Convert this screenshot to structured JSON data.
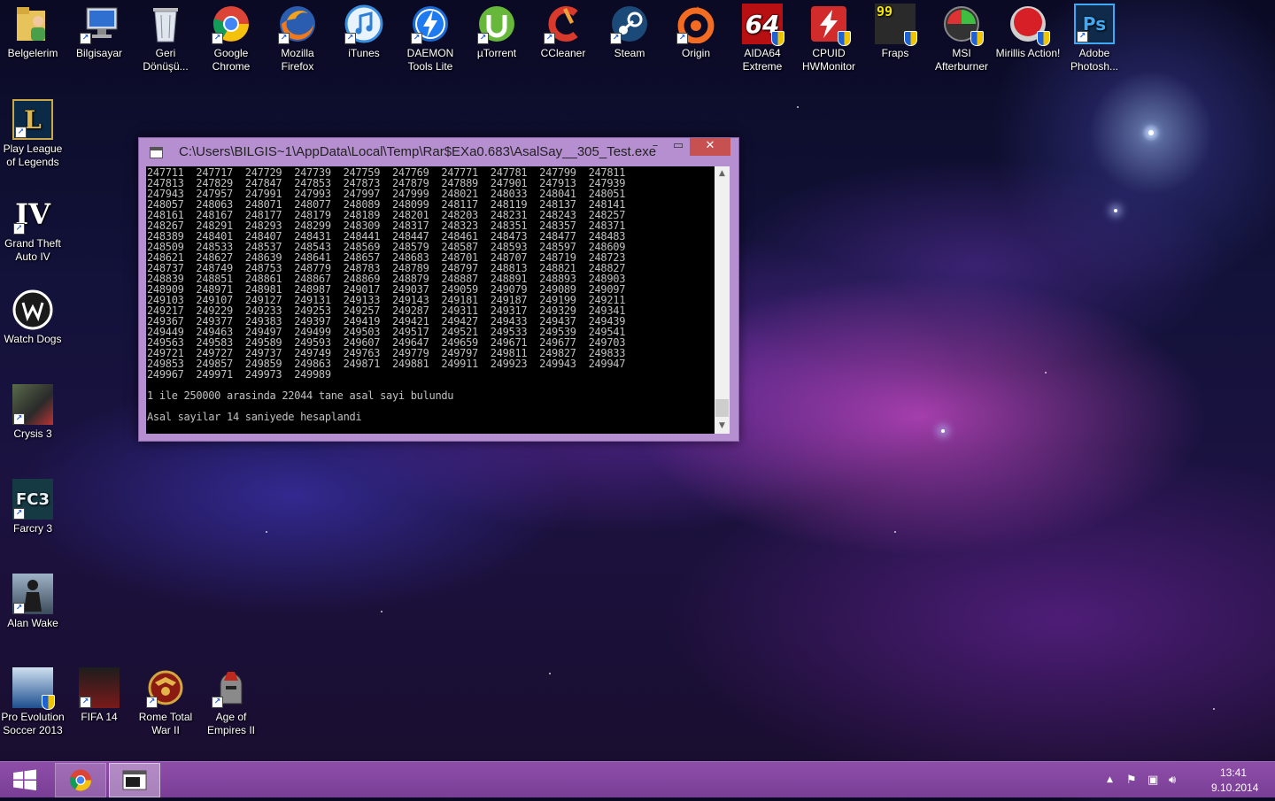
{
  "desktop": {
    "top_row": [
      {
        "label": "Belgelerim",
        "icon": "user-folder-icon"
      },
      {
        "label": "Bilgisayar",
        "icon": "computer-icon"
      },
      {
        "label": "Geri Dönüşü...",
        "icon": "recycle-bin-icon"
      },
      {
        "label": "Google Chrome",
        "icon": "chrome-icon"
      },
      {
        "label": "Mozilla Firefox",
        "icon": "firefox-icon"
      },
      {
        "label": "iTunes",
        "icon": "itunes-icon"
      },
      {
        "label": "DAEMON Tools Lite",
        "icon": "daemon-tools-icon"
      },
      {
        "label": "µTorrent",
        "icon": "utorrent-icon"
      },
      {
        "label": "CCleaner",
        "icon": "ccleaner-icon"
      },
      {
        "label": "Steam",
        "icon": "steam-icon"
      },
      {
        "label": "Origin",
        "icon": "origin-icon"
      },
      {
        "label": "AIDA64 Extreme",
        "icon": "aida64-icon",
        "glyph": "64"
      },
      {
        "label": "CPUID HWMonitor",
        "icon": "hwmonitor-icon"
      },
      {
        "label": "Fraps",
        "icon": "fraps-icon",
        "glyph": "99"
      },
      {
        "label": "MSI Afterburner",
        "icon": "afterburner-icon"
      },
      {
        "label": "Mirillis Action!",
        "icon": "mirillis-action-icon"
      },
      {
        "label": "Adobe Photosh...",
        "icon": "photoshop-icon",
        "glyph": "Ps"
      }
    ],
    "left_column": [
      {
        "label": "Play League of Legends",
        "icon": "league-of-legends-icon",
        "glyph": "L"
      },
      {
        "label": "Grand Theft Auto IV",
        "icon": "gta-iv-icon",
        "glyph": "IV"
      },
      {
        "label": "Watch Dogs",
        "icon": "watch-dogs-icon"
      },
      {
        "label": "Crysis 3",
        "icon": "crysis-3-icon"
      },
      {
        "label": "Farcry 3",
        "icon": "farcry-3-icon",
        "glyph": "FC3"
      },
      {
        "label": "Alan Wake",
        "icon": "alan-wake-icon"
      }
    ],
    "bottom_row": [
      {
        "label": "Pro Evolution Soccer 2013",
        "icon": "pes-2013-icon"
      },
      {
        "label": "FIFA 14",
        "icon": "fifa-14-icon"
      },
      {
        "label": "Rome Total War II",
        "icon": "rome-total-war-icon"
      },
      {
        "label": "Age of Empires II",
        "icon": "age-of-empires-icon"
      }
    ]
  },
  "console": {
    "title": "C:\\Users\\BILGIS~1\\AppData\\Local\\Temp\\Rar$EXa0.683\\AsalSay__305_Test.exe",
    "buttons": {
      "minimize": "–",
      "maximize": "▭",
      "close": "✕"
    },
    "primes": [
      [
        247711,
        247717,
        247729,
        247739,
        247759,
        247769,
        247771,
        247781,
        247799,
        247811
      ],
      [
        247813,
        247829,
        247847,
        247853,
        247873,
        247879,
        247889,
        247901,
        247913,
        247939
      ],
      [
        247943,
        247957,
        247991,
        247993,
        247997,
        247999,
        248021,
        248033,
        248041,
        248051
      ],
      [
        248057,
        248063,
        248071,
        248077,
        248089,
        248099,
        248117,
        248119,
        248137,
        248141
      ],
      [
        248161,
        248167,
        248177,
        248179,
        248189,
        248201,
        248203,
        248231,
        248243,
        248257
      ],
      [
        248267,
        248291,
        248293,
        248299,
        248309,
        248317,
        248323,
        248351,
        248357,
        248371
      ],
      [
        248389,
        248401,
        248407,
        248431,
        248441,
        248447,
        248461,
        248473,
        248477,
        248483
      ],
      [
        248509,
        248533,
        248537,
        248543,
        248569,
        248579,
        248587,
        248593,
        248597,
        248609
      ],
      [
        248621,
        248627,
        248639,
        248641,
        248657,
        248683,
        248701,
        248707,
        248719,
        248723
      ],
      [
        248737,
        248749,
        248753,
        248779,
        248783,
        248789,
        248797,
        248813,
        248821,
        248827
      ],
      [
        248839,
        248851,
        248861,
        248867,
        248869,
        248879,
        248887,
        248891,
        248893,
        248903
      ],
      [
        248909,
        248971,
        248981,
        248987,
        249017,
        249037,
        249059,
        249079,
        249089,
        249097
      ],
      [
        249103,
        249107,
        249127,
        249131,
        249133,
        249143,
        249181,
        249187,
        249199,
        249211
      ],
      [
        249217,
        249229,
        249233,
        249253,
        249257,
        249287,
        249311,
        249317,
        249329,
        249341
      ],
      [
        249367,
        249377,
        249383,
        249397,
        249419,
        249421,
        249427,
        249433,
        249437,
        249439
      ],
      [
        249449,
        249463,
        249497,
        249499,
        249503,
        249517,
        249521,
        249533,
        249539,
        249541
      ],
      [
        249563,
        249583,
        249589,
        249593,
        249607,
        249647,
        249659,
        249671,
        249677,
        249703
      ],
      [
        249721,
        249727,
        249737,
        249749,
        249763,
        249779,
        249797,
        249811,
        249827,
        249833
      ],
      [
        249853,
        249857,
        249859,
        249863,
        249871,
        249881,
        249911,
        249923,
        249943,
        249947
      ],
      [
        249967,
        249971,
        249973,
        249989
      ]
    ],
    "result_line": "1 ile 250000 arasinda 22044 tane asal sayi bulundu",
    "time_line": "Asal sayilar 14 saniyede hesaplandi"
  },
  "taskbar": {
    "apps": [
      {
        "name": "Google Chrome",
        "icon": "chrome-icon"
      },
      {
        "name": "Console",
        "icon": "console-window-icon"
      }
    ],
    "tray": {
      "icons": [
        "show-hidden-icons-icon",
        "action-center-flag-icon",
        "network-icon",
        "volume-icon"
      ],
      "time": "13:41",
      "date": "9.10.2014"
    }
  },
  "colors": {
    "window_frame": "#b58fd0",
    "taskbar": "#8d4ea8",
    "close_button": "#c75050",
    "console_bg": "#000000",
    "console_text": "#c0c0c0"
  }
}
